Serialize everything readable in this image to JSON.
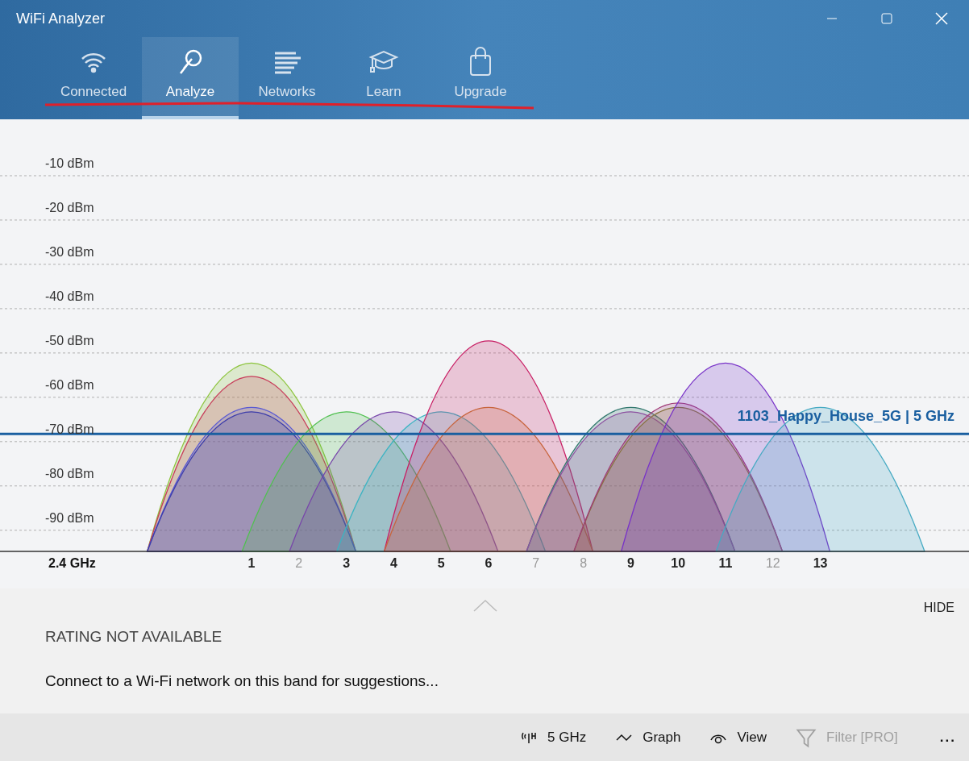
{
  "window": {
    "title": "WiFi Analyzer"
  },
  "tabs": [
    {
      "label": "Connected",
      "selected": false
    },
    {
      "label": "Analyze",
      "selected": true
    },
    {
      "label": "Networks",
      "selected": false
    },
    {
      "label": "Learn",
      "selected": false
    },
    {
      "label": "Upgrade",
      "selected": false
    }
  ],
  "chart": {
    "band_label": "2.4 GHz",
    "y_labels": [
      "-10 dBm",
      "-20 dBm",
      "-30 dBm",
      "-40 dBm",
      "-50 dBm",
      "-60 dBm",
      "-70 dBm",
      "-80 dBm",
      "-90 dBm"
    ],
    "channels": [
      {
        "label": "1",
        "active": true
      },
      {
        "label": "2",
        "active": false
      },
      {
        "label": "3",
        "active": true
      },
      {
        "label": "4",
        "active": true
      },
      {
        "label": "5",
        "active": true
      },
      {
        "label": "6",
        "active": true
      },
      {
        "label": "7",
        "active": false
      },
      {
        "label": "8",
        "active": false
      },
      {
        "label": "9",
        "active": true
      },
      {
        "label": "10",
        "active": true
      },
      {
        "label": "11",
        "active": true
      },
      {
        "label": "12",
        "active": false
      },
      {
        "label": "13",
        "active": true
      }
    ],
    "network_label": "1103_Happy_House_5G | 5 GHz"
  },
  "rating": {
    "toggle": "HIDE",
    "title": "RATING NOT AVAILABLE",
    "message": "Connect to a Wi-Fi network on this band for suggestions..."
  },
  "toolbar": [
    {
      "kind": "band",
      "label": "5 GHz",
      "disabled": false
    },
    {
      "kind": "graph",
      "label": "Graph",
      "disabled": false
    },
    {
      "kind": "view",
      "label": "View",
      "disabled": false
    },
    {
      "kind": "filter",
      "label": "Filter [PRO]",
      "disabled": true
    },
    {
      "kind": "more",
      "label": "...",
      "disabled": false
    }
  ]
}
